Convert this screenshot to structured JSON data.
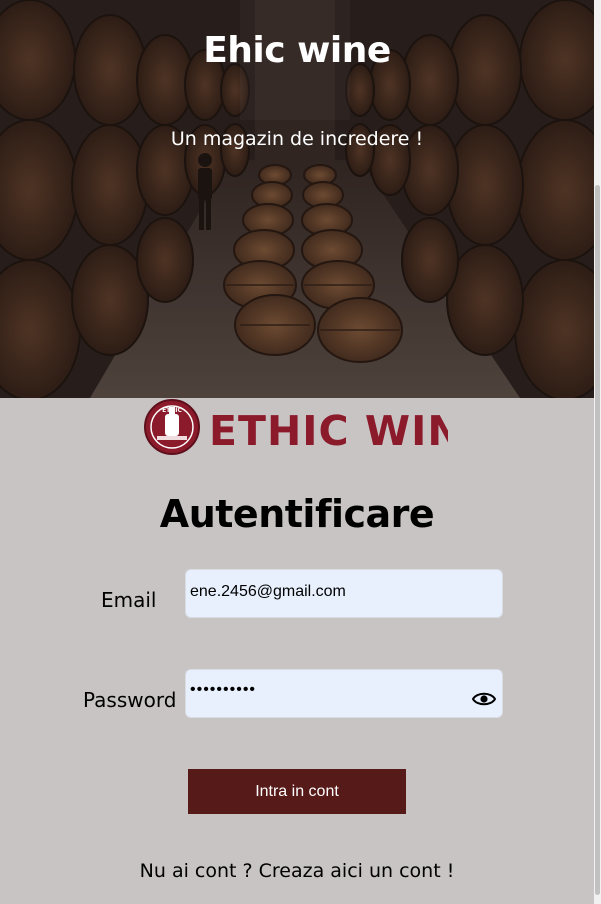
{
  "hero": {
    "title": "Ehic wine",
    "subtitle": "Un magazin de incredere !"
  },
  "logo": {
    "text": "ETHIC WINE",
    "badge_text": "ETHIC",
    "brand_color": "#8b1a2b"
  },
  "form": {
    "title": "Autentificare",
    "email_label": "Email",
    "email_value": "ene.2456@gmail.com",
    "password_label": "Password",
    "password_value": "••••••••••",
    "submit_label": "Intra in cont"
  },
  "signup": {
    "prefix": "Nu ai cont ? ",
    "link_text": "Creaza aici un cont !"
  },
  "colors": {
    "background": "#c9c4c4",
    "input_background": "#e8f0fe",
    "button": "#561b19"
  },
  "icons": {
    "password_toggle": "eye-icon"
  }
}
